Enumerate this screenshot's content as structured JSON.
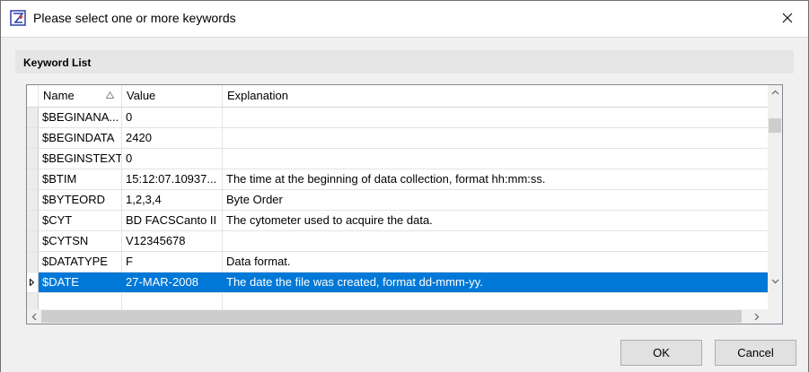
{
  "window": {
    "title": "Please select one or more keywords"
  },
  "group": {
    "title": "Keyword List"
  },
  "grid": {
    "columns": [
      {
        "label": "Name",
        "sorted": "ascending"
      },
      {
        "label": "Value"
      },
      {
        "label": "Explanation"
      }
    ],
    "rows": [
      {
        "name": "$BEGINANA...",
        "value": "0",
        "explanation": ""
      },
      {
        "name": "$BEGINDATA",
        "value": "2420",
        "explanation": ""
      },
      {
        "name": "$BEGINSTEXT",
        "value": "0",
        "explanation": ""
      },
      {
        "name": "$BTIM",
        "value": "15:12:07.10937...",
        "explanation": "The time at the beginning of data collection, format hh:mm:ss."
      },
      {
        "name": "$BYTEORD",
        "value": "1,2,3,4",
        "explanation": "Byte Order"
      },
      {
        "name": "$CYT",
        "value": "BD FACSCanto II",
        "explanation": "The cytometer used to acquire the data."
      },
      {
        "name": "$CYTSN",
        "value": "V12345678",
        "explanation": ""
      },
      {
        "name": "$DATATYPE",
        "value": "F",
        "explanation": "Data format."
      },
      {
        "name": "$DATE",
        "value": "27-MAR-2008",
        "explanation": "The date the file was created, format dd-mmm-yy.",
        "selected": true
      }
    ]
  },
  "buttons": {
    "ok": "OK",
    "cancel": "Cancel"
  },
  "colors": {
    "selection": "#0078d7",
    "row_header": "#ececec",
    "dialog_bg": "#f0f0f0"
  },
  "icons": {
    "app": "keyword-app-icon",
    "close": "close-icon",
    "sort": "sort-ascending-icon"
  }
}
